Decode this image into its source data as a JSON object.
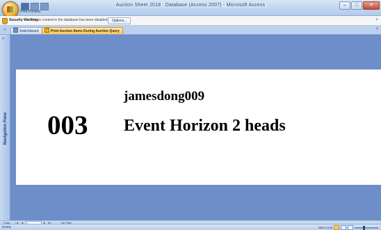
{
  "window": {
    "title": "Auction Sheet 2018 : Database (Access 2007) - Microsoft Access",
    "ribbon_tab": "Print Preview",
    "controls": [
      "–",
      "□",
      "✕"
    ]
  },
  "security_bar": {
    "label": "Security Warning",
    "message": "Certain content in the database has been disabled",
    "options_button": "Options...",
    "close": "×"
  },
  "tabs": [
    {
      "label": "Switchboard",
      "icon": "form-icon"
    },
    {
      "label": "Print Auction Items During Auction Query",
      "icon": "report-icon"
    }
  ],
  "tab_close": "×",
  "nav_pane": {
    "label": "Navigation Pane",
    "toggle": "»"
  },
  "report": {
    "item_number": "003",
    "seller": "jamesdong009",
    "item_name": "Event Horizon 2 heads"
  },
  "pager": {
    "label": "Page:",
    "first": "|◄",
    "prev": "◄",
    "page": "1",
    "next": "►",
    "last": "►|",
    "filter": "No Filter"
  },
  "status": {
    "text": "Ready",
    "zoom_label": "Num Lock",
    "zoom_level": 0.35
  }
}
